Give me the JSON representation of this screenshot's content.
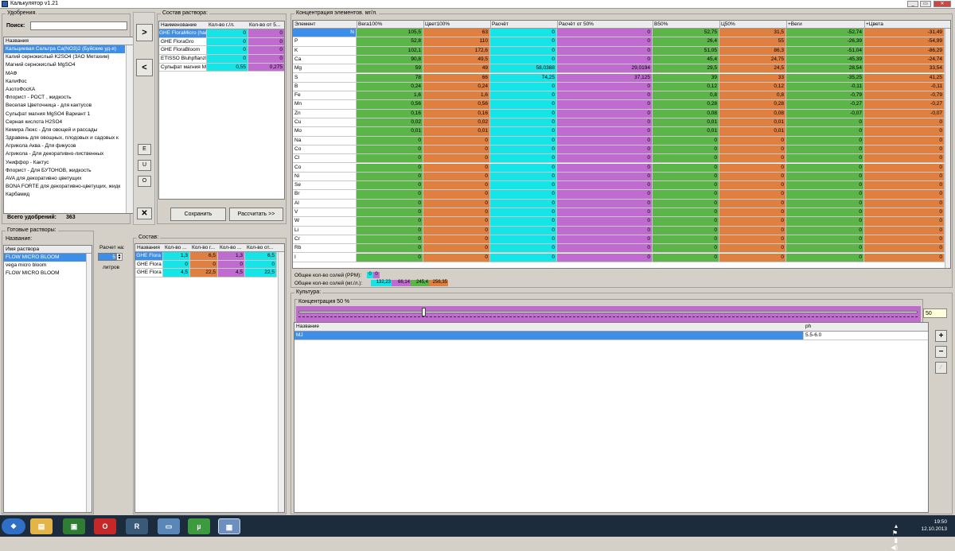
{
  "window": {
    "title": "Калькулятор v1.21"
  },
  "fert": {
    "group_label": "Удобрения.",
    "search_label": "Поиск:",
    "search_value": "",
    "col_header": "Названия",
    "items": [
      "Кальциевая Сельтра Ca(NO3)2 (Буйские уд-я)",
      "Калий  сернокислый  K2SO4 (ЗАО Метахим)",
      "Магний сернокислый MgSO4",
      "МАФ",
      "КалиФос",
      "АзотоФосКА",
      "Флорист - РОСТ , жидкость",
      "Веселая Цветочница - для кактусов",
      "Сульфат магния MgSO4 Вариант 1",
      "Серная кислота H2SO4",
      "Кемира Люкс - Для овощей и рассады",
      "Здравень для овощных, плодовых и садовых к",
      "Агрикола Аква - Для фикусов",
      "Агрикола - Для декоративно-лиственных",
      "Униффор - Кактус",
      "Флорист - Для БУТОНОВ, жидкость",
      "AVA для декоративно цветущих",
      "BONA FORTE для декоративно-цветущих, жидк",
      "Карбамид"
    ],
    "total_label": "Всего удобрений:",
    "total_value": "363"
  },
  "mid_buttons": {
    "add": ">",
    "remove": "<",
    "e": "E",
    "u": "U",
    "o": "O",
    "del": "✕"
  },
  "solution": {
    "group_label": "Состав раствора:",
    "headers": [
      "Наименование",
      "Кол-во г./л.",
      "Кол-во от 5..."
    ],
    "rows": [
      [
        "GHE FloraMicro (har",
        "0",
        "0"
      ],
      [
        "GHE FloraGro",
        "0",
        "0"
      ],
      [
        "GHE FloraBloom",
        "0",
        "0"
      ],
      [
        "ETISSO BluhpflanzI",
        "0",
        "0"
      ],
      [
        "Сульфат магния M",
        "0,55",
        "0,275"
      ]
    ],
    "save": "Сохранить",
    "calc": "Рассчитать >>"
  },
  "ready": {
    "group_label": "Готовые растворы:",
    "name_label": "Название:",
    "col_header": "Имя раствора",
    "items": [
      "FLOW MICRO BLOOM",
      "vega micro bloom",
      "FLOW MICRO BLOOM"
    ],
    "calc_label": "Расчет на:",
    "calc_value": "5",
    "liters": "литров"
  },
  "comp": {
    "group_label": "Состав:",
    "headers": [
      "Названия",
      "Кол-во ...",
      "Кол-во г...",
      "Кол-во ...",
      "Кол-во от..."
    ],
    "rows": [
      [
        "GHE Flora",
        "1,3",
        "6,5",
        "1,3",
        "6,5"
      ],
      [
        "GHE Flora",
        "0",
        "0",
        "0",
        "0"
      ],
      [
        "GHE Flora",
        "4,5",
        "22,5",
        "4,5",
        "22,5"
      ]
    ]
  },
  "conc": {
    "group_label": "Концентрация элементов. мг/л.",
    "headers": [
      "Элемент",
      "Вега100%",
      "Цвет100%",
      "Расчёт",
      "Расчёт от 50%",
      "В50%",
      "Ц50%",
      "+Веги",
      "+Цвета"
    ],
    "rows": [
      [
        "N",
        "105,5",
        "63",
        "0",
        "0",
        "52,75",
        "31,5",
        "-52,74",
        "-31,49"
      ],
      [
        "P",
        "52,8",
        "110",
        "0",
        "0",
        "26,4",
        "55",
        "-26,39",
        "-54,99"
      ],
      [
        "K",
        "102,1",
        "172,6",
        "0",
        "0",
        "51,05",
        "86,3",
        "-51,04",
        "-86,29"
      ],
      [
        "Ca",
        "90,8",
        "49,5",
        "0",
        "0",
        "45,4",
        "24,75",
        "-45,39",
        "-24,74"
      ],
      [
        "Mg",
        "59",
        "49",
        "58,0388",
        "29,0194",
        "29,5",
        "24,5",
        "28,54",
        "33,54"
      ],
      [
        "S",
        "78",
        "66",
        "74,25",
        "37,125",
        "39",
        "33",
        "-35,25",
        "41,25"
      ],
      [
        "B",
        "0,24",
        "0,24",
        "0",
        "0",
        "0,12",
        "0,12",
        "-0,11",
        "-0,11"
      ],
      [
        "Fe",
        "1,6",
        "1,6",
        "0",
        "0",
        "0,8",
        "0,8",
        "-0,79",
        "-0,79"
      ],
      [
        "Mn",
        "0,56",
        "0,56",
        "0",
        "0",
        "0,28",
        "0,28",
        "-0,27",
        "-0,27"
      ],
      [
        "Zn",
        "0,16",
        "0,16",
        "0",
        "0",
        "0,08",
        "0,08",
        "-0,07",
        "-0,07"
      ],
      [
        "Cu",
        "0,02",
        "0,02",
        "0",
        "0",
        "0,01",
        "0,01",
        "0",
        "0"
      ],
      [
        "Mo",
        "0,01",
        "0,01",
        "0",
        "0",
        "0,01",
        "0,01",
        "0",
        "0"
      ],
      [
        "Na",
        "0",
        "0",
        "0",
        "0",
        "0",
        "0",
        "0",
        "0"
      ],
      [
        "Co",
        "0",
        "0",
        "0",
        "0",
        "0",
        "0",
        "0",
        "0"
      ],
      [
        "Cl",
        "0",
        "0",
        "0",
        "0",
        "0",
        "0",
        "0",
        "0"
      ],
      [
        "Co",
        "0",
        "0",
        "0",
        "0",
        "0",
        "0",
        "0",
        "0"
      ],
      [
        "Ni",
        "0",
        "0",
        "0",
        "0",
        "0",
        "0",
        "0",
        "0"
      ],
      [
        "Se",
        "0",
        "0",
        "0",
        "0",
        "0",
        "0",
        "0",
        "0"
      ],
      [
        "Br",
        "0",
        "0",
        "0",
        "0",
        "0",
        "0",
        "0",
        "0"
      ],
      [
        "Al",
        "0",
        "0",
        "0",
        "0",
        "0",
        "0",
        "0",
        "0"
      ],
      [
        "V",
        "0",
        "0",
        "0",
        "0",
        "0",
        "0",
        "0",
        "0"
      ],
      [
        "W",
        "0",
        "0",
        "0",
        "0",
        "0",
        "0",
        "0",
        "0"
      ],
      [
        "Li",
        "0",
        "0",
        "0",
        "0",
        "0",
        "0",
        "0",
        "0"
      ],
      [
        "Cr",
        "0",
        "0",
        "0",
        "0",
        "0",
        "0",
        "0",
        "0"
      ],
      [
        "Rb",
        "0",
        "0",
        "0",
        "0",
        "0",
        "0",
        "0",
        "0"
      ],
      [
        "I",
        "0",
        "0",
        "0",
        "0",
        "0",
        "0",
        "0",
        "0"
      ]
    ],
    "ppm_label": "Общее кол-во солей (PPM):",
    "ppm_values": [
      "0",
      "0"
    ],
    "mg_label": "Общее кол-во солей (мг./л.):",
    "mg_values": [
      "132,23",
      "66,14",
      "245,4",
      "256,35"
    ]
  },
  "culture": {
    "group_label": "Культура:",
    "conc_label": "Концентрация 50 %",
    "conc_fraction": 0.5,
    "conc_value": "50",
    "headers": [
      "Название",
      "ph"
    ],
    "rows": [
      [
        "MJ",
        "5.5-6.0"
      ]
    ],
    "plus": "+",
    "minus": "−"
  },
  "taskbar": {
    "time": "19:50",
    "date": "12.10.2013"
  }
}
